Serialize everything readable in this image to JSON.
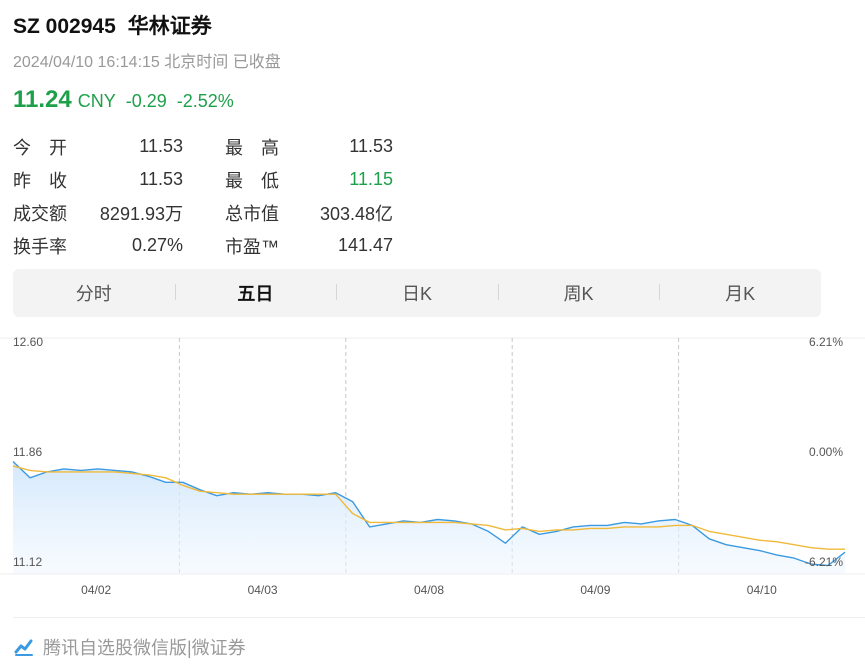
{
  "header": {
    "code": "SZ 002945",
    "name": "华林证券",
    "timestamp": "2024/04/10 16:14:15 北京时间 已收盘"
  },
  "quote": {
    "price": "11.24",
    "currency": "CNY",
    "change": "-0.29",
    "change_pct": "-2.52%",
    "color_down": "#1ea04b"
  },
  "stats": [
    {
      "l1": "今　开",
      "v1": "11.53",
      "l2": "最　高",
      "v2": "11.53"
    },
    {
      "l1": "昨　收",
      "v1": "11.53",
      "l2": "最　低",
      "v2": "11.15"
    },
    {
      "l1": "成交额",
      "v1": "8291.93万",
      "l2": "总市值",
      "v2": "303.48亿"
    },
    {
      "l1": "换手率",
      "v1": "0.27%",
      "l2": "市盈™",
      "v2": "141.47"
    }
  ],
  "tabs": [
    "分时",
    "五日",
    "日K",
    "周K",
    "月K"
  ],
  "active_tab": "五日",
  "chart_data": {
    "type": "line",
    "y_left_ticks": [
      "12.60",
      "11.86",
      "11.12"
    ],
    "y_right_ticks": [
      "6.21%",
      "0.00%",
      "-6.21%"
    ],
    "ylim": [
      11.12,
      12.6
    ],
    "x_labels": [
      "04/02",
      "04/03",
      "04/08",
      "04/09",
      "04/10"
    ],
    "series": [
      {
        "values": [
          11.85,
          11.74,
          11.78,
          11.8,
          11.79,
          11.8,
          11.79,
          11.78,
          11.75,
          11.71,
          11.71,
          11.66,
          11.62,
          11.64,
          11.63,
          11.64,
          11.63,
          11.63,
          11.62,
          11.64,
          11.58,
          11.41,
          11.43,
          11.45,
          11.44,
          11.46,
          11.45,
          11.43,
          11.38,
          11.3,
          11.41,
          11.36,
          11.38,
          11.41,
          11.42,
          11.42,
          11.44,
          11.43,
          11.45,
          11.46,
          11.42,
          11.33,
          11.29,
          11.27,
          11.25,
          11.22,
          11.2,
          11.16,
          11.15,
          11.24
        ],
        "color": "#3b9ae1"
      },
      {
        "values": [
          11.82,
          11.79,
          11.78,
          11.78,
          11.78,
          11.78,
          11.78,
          11.77,
          11.76,
          11.74,
          11.69,
          11.65,
          11.64,
          11.63,
          11.63,
          11.63,
          11.63,
          11.63,
          11.63,
          11.63,
          11.5,
          11.44,
          11.44,
          11.44,
          11.44,
          11.44,
          11.44,
          11.43,
          11.42,
          11.39,
          11.4,
          11.38,
          11.39,
          11.39,
          11.4,
          11.4,
          11.41,
          11.41,
          11.41,
          11.42,
          11.42,
          11.38,
          11.36,
          11.34,
          11.32,
          11.31,
          11.29,
          11.27,
          11.26,
          11.26
        ],
        "color": "#f0b93a"
      }
    ]
  },
  "footer": {
    "text": "腾讯自选股微信版|微证券"
  }
}
